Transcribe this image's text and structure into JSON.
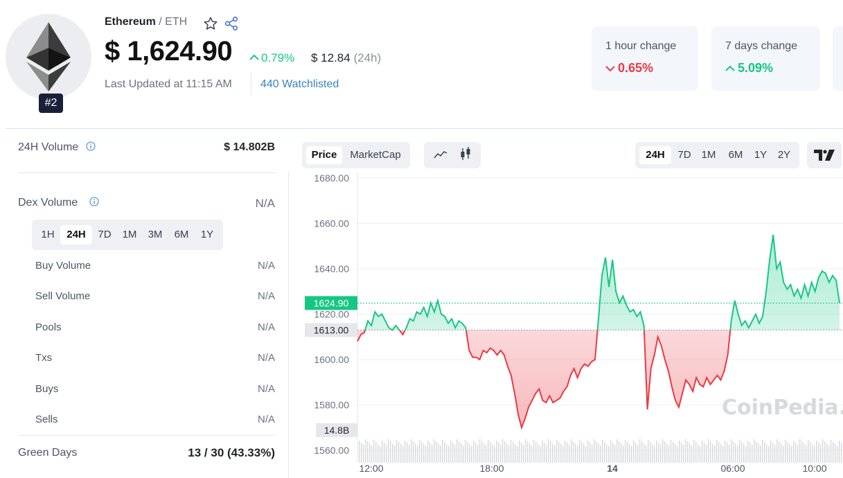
{
  "header": {
    "name": "Ethereum",
    "separator": " / ",
    "symbol": "ETH",
    "rank": "#2",
    "price": "$ 1,624.90",
    "change_24h": "0.79%",
    "volume_24h": "$ 12.84",
    "volume_24h_suffix": "(24h)",
    "last_updated": "Last Updated at 11:15 AM",
    "watchlisted": "440 Watchlisted"
  },
  "cards": [
    {
      "title": "1 hour change",
      "value": "0.65%",
      "direction": "down",
      "color": "#ea3943"
    },
    {
      "title": "7 days change",
      "value": "5.09%",
      "direction": "up",
      "color": "#16c784"
    }
  ],
  "left_panel": {
    "volume_label": "24H Volume",
    "volume_value": "$ 14.802B",
    "dex_label": "Dex Volume",
    "dex_value": "N/A",
    "timeframes": [
      "1H",
      "24H",
      "7D",
      "1M",
      "3M",
      "6M",
      "1Y"
    ],
    "active_timeframe": "24H",
    "rows": [
      {
        "label": "Buy Volume",
        "value": "N/A"
      },
      {
        "label": "Sell Volume",
        "value": "N/A"
      },
      {
        "label": "Pools",
        "value": "N/A"
      },
      {
        "label": "Txs",
        "value": "N/A"
      },
      {
        "label": "Buys",
        "value": "N/A"
      },
      {
        "label": "Sells",
        "value": "N/A"
      }
    ],
    "green_days_label": "Green Days",
    "green_days_value": "13 / 30 (43.33%)"
  },
  "chart_controls": {
    "price_tab": "Price",
    "marketcap_tab": "MarketCap",
    "ranges": [
      "24H",
      "7D",
      "1M",
      "6M",
      "1Y",
      "2Y"
    ],
    "active_range": "24H"
  },
  "chart_data": {
    "type": "area",
    "y_ticks": [
      "1680.00",
      "1660.00",
      "1640.00",
      "1620.00",
      "1600.00",
      "1580.00",
      "1560.00"
    ],
    "x_ticks": [
      "12:00",
      "18:00",
      "14",
      "06:00",
      "10:00"
    ],
    "ylim": [
      1560,
      1684
    ],
    "baseline": 1613.0,
    "baseline_label": "1613.00",
    "current_price": 1624.9,
    "current_price_label": "1624.90",
    "volume_label": "14.8B",
    "watermark": "CoinPedia.",
    "colors": {
      "up": "#16c784",
      "down": "#ea3943"
    },
    "values": [
      1608,
      1611,
      1612,
      1617,
      1615,
      1621,
      1619,
      1620,
      1617,
      1614,
      1613,
      1615,
      1613,
      1611,
      1614,
      1618,
      1617,
      1621,
      1620,
      1623,
      1619,
      1625,
      1621,
      1626,
      1620,
      1619,
      1616,
      1618,
      1614,
      1617,
      1616,
      1614,
      1604,
      1601,
      1601,
      1600,
      1604,
      1603,
      1605,
      1604,
      1602,
      1604,
      1602,
      1597,
      1593,
      1585,
      1576,
      1570,
      1574,
      1579,
      1582,
      1585,
      1587,
      1582,
      1581,
      1584,
      1581,
      1582,
      1583,
      1586,
      1588,
      1593,
      1596,
      1592,
      1596,
      1598,
      1597,
      1599,
      1600,
      1618,
      1637,
      1645,
      1632,
      1644,
      1630,
      1625,
      1628,
      1624,
      1621,
      1622,
      1619,
      1621,
      1615,
      1578,
      1596,
      1602,
      1610,
      1606,
      1600,
      1595,
      1588,
      1582,
      1579,
      1585,
      1591,
      1589,
      1586,
      1592,
      1589,
      1588,
      1592,
      1589,
      1591,
      1593,
      1591,
      1595,
      1602,
      1617,
      1626,
      1620,
      1615,
      1617,
      1614,
      1617,
      1620,
      1616,
      1619,
      1630,
      1644,
      1655,
      1640,
      1643,
      1634,
      1631,
      1633,
      1628,
      1631,
      1627,
      1633,
      1628,
      1634,
      1630,
      1636,
      1639,
      1638,
      1634,
      1637,
      1635,
      1625
    ]
  }
}
